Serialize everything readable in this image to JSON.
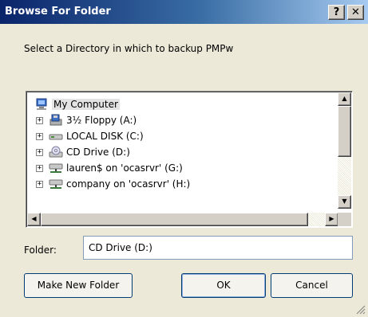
{
  "window": {
    "title": "Browse For Folder",
    "help_label": "?",
    "close_label": "✕"
  },
  "prompt": "Select a Directory in which to backup PMPw",
  "tree": {
    "items": [
      {
        "label": "My Computer",
        "icon": "my-computer-icon",
        "expander": "",
        "selected": true
      },
      {
        "label": "3½ Floppy (A:)",
        "icon": "floppy-drive-icon",
        "expander": "+"
      },
      {
        "label": "LOCAL DISK (C:)",
        "icon": "hard-disk-icon",
        "expander": "+"
      },
      {
        "label": "CD Drive (D:)",
        "icon": "cd-drive-icon",
        "expander": "+"
      },
      {
        "label": "lauren$ on 'ocasrvr' (G:)",
        "icon": "network-drive-icon",
        "expander": "+"
      },
      {
        "label": "company on 'ocasrvr' (H:)",
        "icon": "network-drive-icon",
        "expander": "+"
      }
    ]
  },
  "folder": {
    "label": "Folder:",
    "value": "CD Drive (D:)"
  },
  "buttons": {
    "make_new_folder": "Make New Folder",
    "ok": "OK",
    "cancel": "Cancel"
  },
  "colors": {
    "title_gradient_start": "#0a246a",
    "title_gradient_end": "#a6caf0",
    "dialog_face": "#ece9d8"
  }
}
